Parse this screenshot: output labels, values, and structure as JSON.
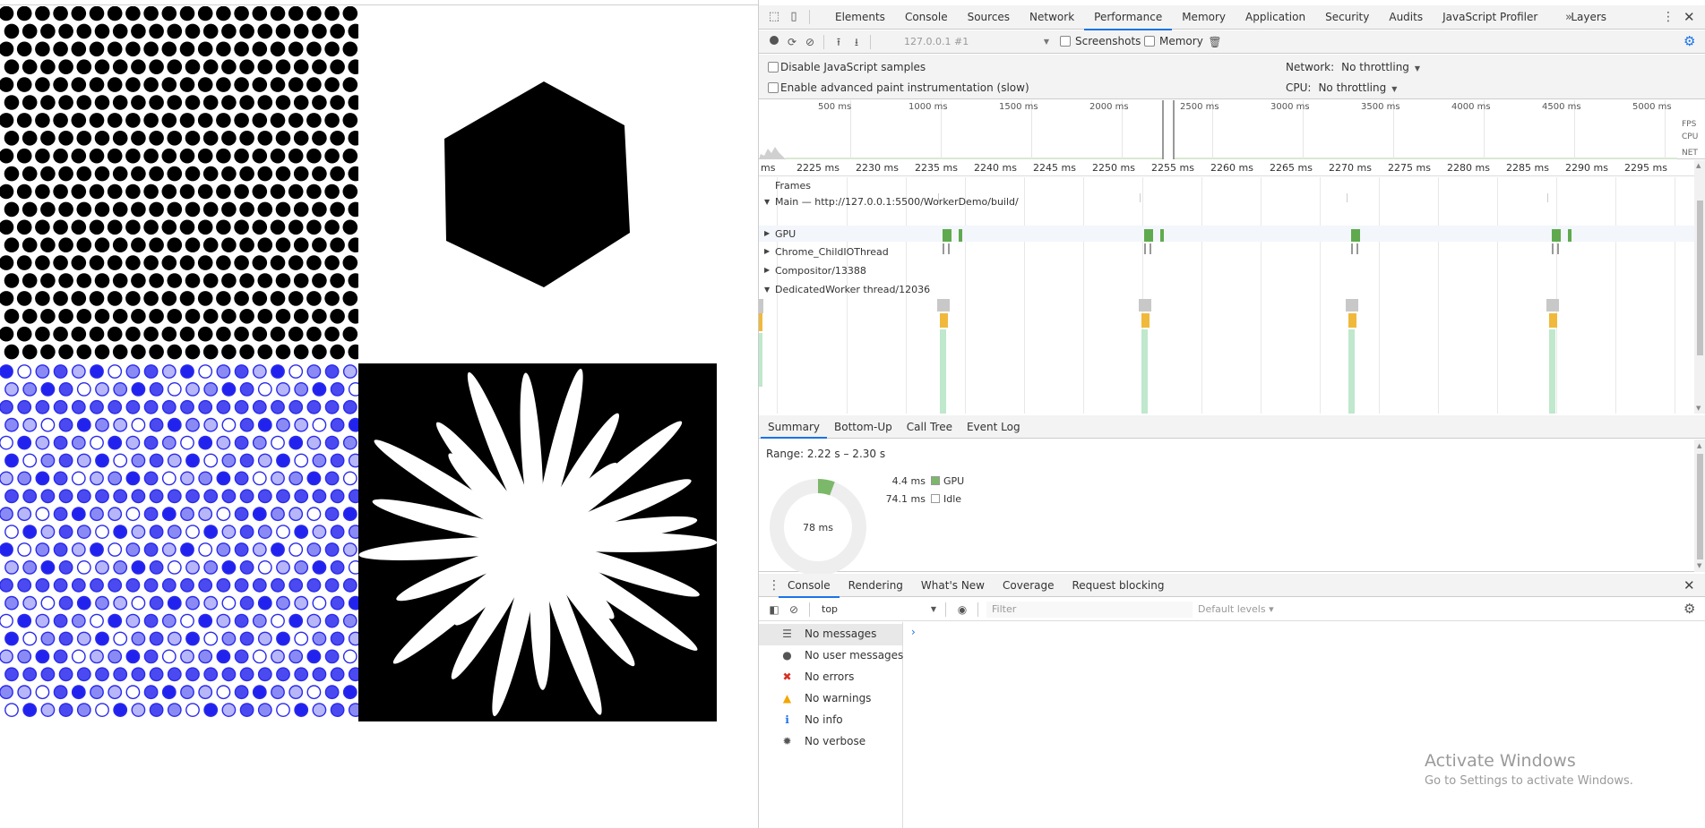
{
  "devtools": {
    "tabs": [
      "Elements",
      "Console",
      "Sources",
      "Network",
      "Performance",
      "Memory",
      "Application",
      "Security",
      "Audits",
      "JavaScript Profiler",
      "Layers"
    ],
    "active_tab": "Performance",
    "more_tabs": "»"
  },
  "toolbar": {
    "recording_select": "127.0.0.1 #1",
    "screenshots_label": "Screenshots",
    "memory_label": "Memory"
  },
  "settings": {
    "disable_js_samples": "Disable JavaScript samples",
    "advanced_paint": "Enable advanced paint instrumentation (slow)",
    "network_label": "Network:",
    "network_value": "No throttling",
    "cpu_label": "CPU:",
    "cpu_value": "No throttling"
  },
  "overview": {
    "ticks": [
      "500 ms",
      "1000 ms",
      "1500 ms",
      "2000 ms",
      "2500 ms",
      "3000 ms",
      "3500 ms",
      "4000 ms",
      "4500 ms",
      "5000 ms"
    ],
    "fps": "FPS",
    "cpu": "CPU",
    "net": "NET"
  },
  "timeline": {
    "ticks": [
      "ms",
      "2225 ms",
      "2230 ms",
      "2235 ms",
      "2240 ms",
      "2245 ms",
      "2250 ms",
      "2255 ms",
      "2260 ms",
      "2265 ms",
      "2270 ms",
      "2275 ms",
      "2280 ms",
      "2285 ms",
      "2290 ms",
      "2295 ms"
    ],
    "frames_label": "Frames",
    "main_label": "Main — http://127.0.0.1:5500/WorkerDemo/build/",
    "gpu_label": "GPU",
    "io_label": "Chrome_ChildIOThread",
    "compositor_label": "Compositor/13388",
    "worker_label": "DedicatedWorker thread/12036"
  },
  "detail_tabs": [
    "Summary",
    "Bottom-Up",
    "Call Tree",
    "Event Log"
  ],
  "summary": {
    "range": "Range: 2.22 s – 2.30 s",
    "total": "78 ms",
    "rows": [
      {
        "value": "4.4 ms",
        "label": "GPU",
        "color": "#7cb869"
      },
      {
        "value": "74.1 ms",
        "label": "Idle",
        "color": "#ffffff"
      }
    ]
  },
  "drawer": {
    "tabs": [
      "Console",
      "Rendering",
      "What's New",
      "Coverage",
      "Request blocking"
    ],
    "context": "top",
    "filter_placeholder": "Filter",
    "levels": "Default levels ▾",
    "prompt": "›"
  },
  "console_sidebar": [
    {
      "label": "No messages",
      "icon": "list-icon",
      "color": "#555"
    },
    {
      "label": "No user messages",
      "icon": "user-icon",
      "color": "#555"
    },
    {
      "label": "No errors",
      "icon": "error-icon",
      "color": "#d93025"
    },
    {
      "label": "No warnings",
      "icon": "warning-icon",
      "color": "#f2a600"
    },
    {
      "label": "No info",
      "icon": "info-icon",
      "color": "#1a73e8"
    },
    {
      "label": "No verbose",
      "icon": "bug-icon",
      "color": "#555"
    }
  ],
  "watermark": {
    "line1": "Activate Windows",
    "line2": "Go to Settings to activate Windows."
  }
}
